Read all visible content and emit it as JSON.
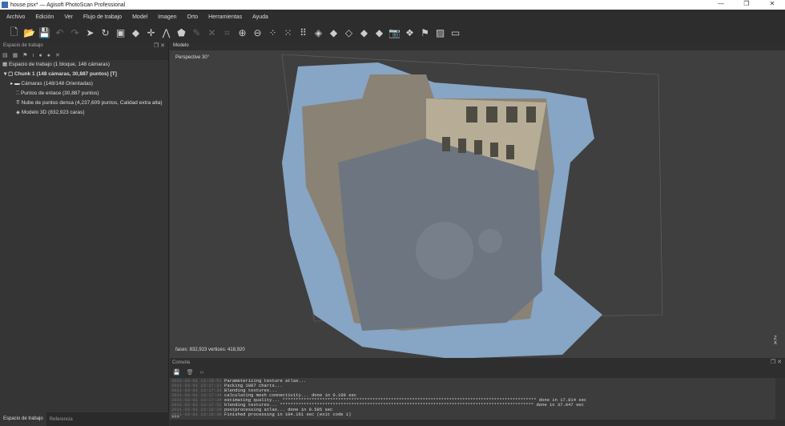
{
  "window": {
    "title": "house.psx* — Agisoft PhotoScan Professional",
    "controls": [
      "—",
      "❐",
      "✕"
    ]
  },
  "menu": [
    "Archivo",
    "Edición",
    "Ver",
    "Flujo de trabajo",
    "Model",
    "Imagen",
    "Orto",
    "Herramientas",
    "Ayuda"
  ],
  "toolbar": [
    {
      "name": "new-icon",
      "glyph": "🗋"
    },
    {
      "name": "open-icon",
      "glyph": "📂"
    },
    {
      "name": "save-icon",
      "glyph": "💾"
    },
    {
      "name": "undo-icon",
      "glyph": "↶",
      "dim": true
    },
    {
      "name": "redo-icon",
      "glyph": "↷",
      "dim": true
    },
    {
      "name": "select-arrow-icon",
      "glyph": "➤"
    },
    {
      "name": "rotate-icon",
      "glyph": "↻"
    },
    {
      "name": "rectangle-select-icon",
      "glyph": "▣"
    },
    {
      "name": "navigation-icon",
      "glyph": "◆"
    },
    {
      "name": "point-icon",
      "glyph": "✛"
    },
    {
      "name": "ruler-icon",
      "glyph": "⋀"
    },
    {
      "name": "polygon-icon",
      "glyph": "⬟"
    },
    {
      "name": "pencil-icon",
      "glyph": "✎",
      "dim": true
    },
    {
      "name": "delete-icon",
      "glyph": "✕",
      "dim": true
    },
    {
      "name": "crop-icon",
      "glyph": "⌗",
      "dim": true
    },
    {
      "name": "zoom-in-icon",
      "glyph": "⊕"
    },
    {
      "name": "zoom-out-icon",
      "glyph": "⊖"
    },
    {
      "name": "dots-icon",
      "glyph": "⁘"
    },
    {
      "name": "grid-icon",
      "glyph": "⁙"
    },
    {
      "name": "dense-cloud-icon",
      "glyph": "⠿"
    },
    {
      "name": "mesh-icon",
      "glyph": "◈"
    },
    {
      "name": "solid-icon",
      "glyph": "◆"
    },
    {
      "name": "wireframe-icon",
      "glyph": "◇"
    },
    {
      "name": "shaded-icon",
      "glyph": "◆"
    },
    {
      "name": "textured-icon",
      "glyph": "◆"
    },
    {
      "name": "camera-icon",
      "glyph": "📷"
    },
    {
      "name": "shapes-icon",
      "glyph": "❖"
    },
    {
      "name": "flag-icon",
      "glyph": "⚑"
    },
    {
      "name": "image-icon",
      "glyph": "▨"
    },
    {
      "name": "panel-icon",
      "glyph": "▭"
    }
  ],
  "workspace": {
    "panel_title": "Espacio de trabajo",
    "root": "Espacio de trabajo (1 bloque, 148 cámaras)",
    "chunk": "Chunk 1 (148 cámaras, 30,887 puntos) [T]",
    "items": [
      "Cámaras (148/148 Orientadas)",
      "Puntos de enlace (30,887 puntos)",
      "Nube de puntos densa (4,237,609 puntos, Calidad extra alta)",
      "Modelo 3D (832,923 caras)"
    ],
    "tabs": [
      "Espacio de trabajo",
      "Referencia"
    ]
  },
  "model": {
    "tab": "Modelo",
    "projection": "Perspective 30°",
    "stats": "faces: 832,923 vertices: 418,920",
    "axis_z": "Z",
    "axis_x": "X"
  },
  "console": {
    "title": "Consola",
    "lines": [
      {
        "ts": "2021-03-01 13:16:51",
        "msg": "Parameterizing texture atlas..."
      },
      {
        "ts": "2021-03-01 13:17:21",
        "msg": "Packing 1887 charts..."
      },
      {
        "ts": "2021-03-01 13:17:33",
        "msg": "Blending textures..."
      },
      {
        "ts": "2021-03-01 13:17:34",
        "msg": "calculating mesh connectivity... done in 0.199 sec"
      },
      {
        "ts": "2021-03-01 13:17:34",
        "msg": "estimating quality... ************************************************************************************************ done in 17.814 sec"
      },
      {
        "ts": "2021-03-01 13:17:52",
        "msg": "blending textures... ************************************************************************************************ done in 37.047 sec"
      },
      {
        "ts": "2021-03-01 13:18:29",
        "msg": "postprocessing atlas... done in 0.585 sec"
      },
      {
        "ts": "2021-03-01 13:18:36",
        "msg": "Finished processing in 104.161 sec (exit code 1)"
      }
    ],
    "prompt": ">>>"
  }
}
